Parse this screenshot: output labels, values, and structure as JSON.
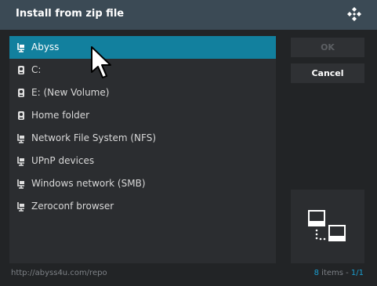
{
  "dialog": {
    "title": "Install from zip file",
    "logo_icon": "kodi-logo-icon"
  },
  "list": {
    "items": [
      {
        "label": "Abyss",
        "icon": "network-share-icon",
        "focused": true
      },
      {
        "label": "C:",
        "icon": "drive-icon"
      },
      {
        "label": "E: (New Volume)",
        "icon": "drive-icon"
      },
      {
        "label": "Home folder",
        "icon": "drive-icon"
      },
      {
        "label": "Network File System (NFS)",
        "icon": "network-share-icon"
      },
      {
        "label": "UPnP devices",
        "icon": "network-share-icon"
      },
      {
        "label": "Windows network (SMB)",
        "icon": "network-share-icon"
      },
      {
        "label": "Zeroconf browser",
        "icon": "network-share-icon"
      }
    ]
  },
  "buttons": {
    "ok": "OK",
    "cancel": "Cancel"
  },
  "preview": {
    "icon": "network-computers-icon"
  },
  "footer": {
    "path": "http://abyss4u.com/repo",
    "count": "8",
    "count_suffix": " items - ",
    "page": "1/1"
  },
  "colors": {
    "accent": "#12809e",
    "highlight_text": "#1a9fd1",
    "titlebar": "#3b4a55"
  }
}
